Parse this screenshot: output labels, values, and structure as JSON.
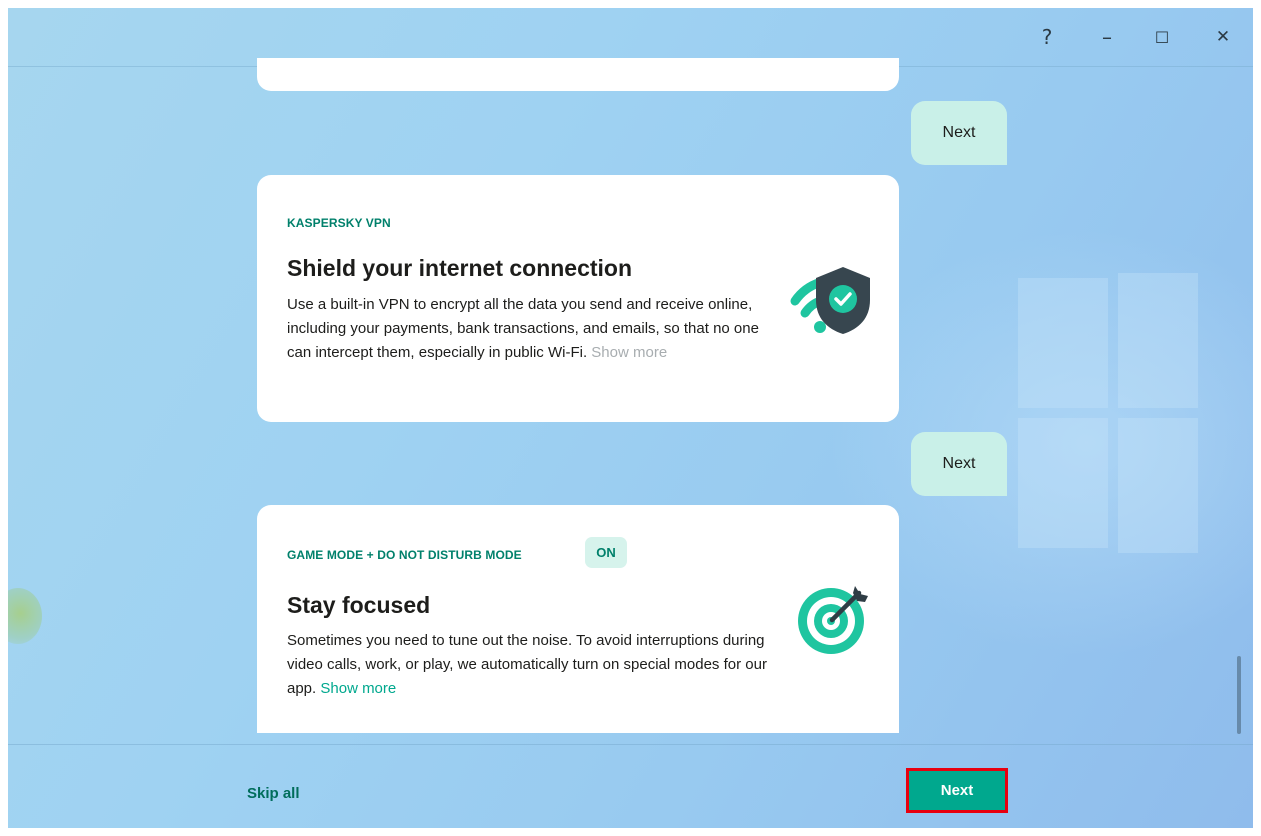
{
  "window_controls": {
    "help": "?",
    "minimize": "–",
    "maximize": "☐",
    "close": "✕"
  },
  "cards": {
    "vpn": {
      "eyebrow": "KASPERSKY VPN",
      "title": "Shield your internet connection",
      "text": "Use a built-in VPN to encrypt all the data you send and receive online, including your payments, bank transactions, and emails, so that no one can intercept them, especially in public Wi-Fi.",
      "show_more": "Show more",
      "icon": "wifi-shield-icon"
    },
    "game": {
      "eyebrow": "GAME MODE + DO NOT DISTURB MODE",
      "badge": "ON",
      "title": "Stay focused",
      "text": "Sometimes you need to tune out the noise. To avoid interruptions during video calls, work, or play, we automatically turn on special modes for our app.",
      "show_more": "Show more",
      "icon": "target-icon"
    }
  },
  "bubbles": {
    "first": "Next",
    "second": "Next"
  },
  "footer": {
    "skip": "Skip all",
    "next": "Next"
  },
  "colors": {
    "accent": "#00a88e",
    "accent_dark": "#00806b",
    "bubble": "#c9f0e8",
    "highlight": "#e8000f"
  }
}
